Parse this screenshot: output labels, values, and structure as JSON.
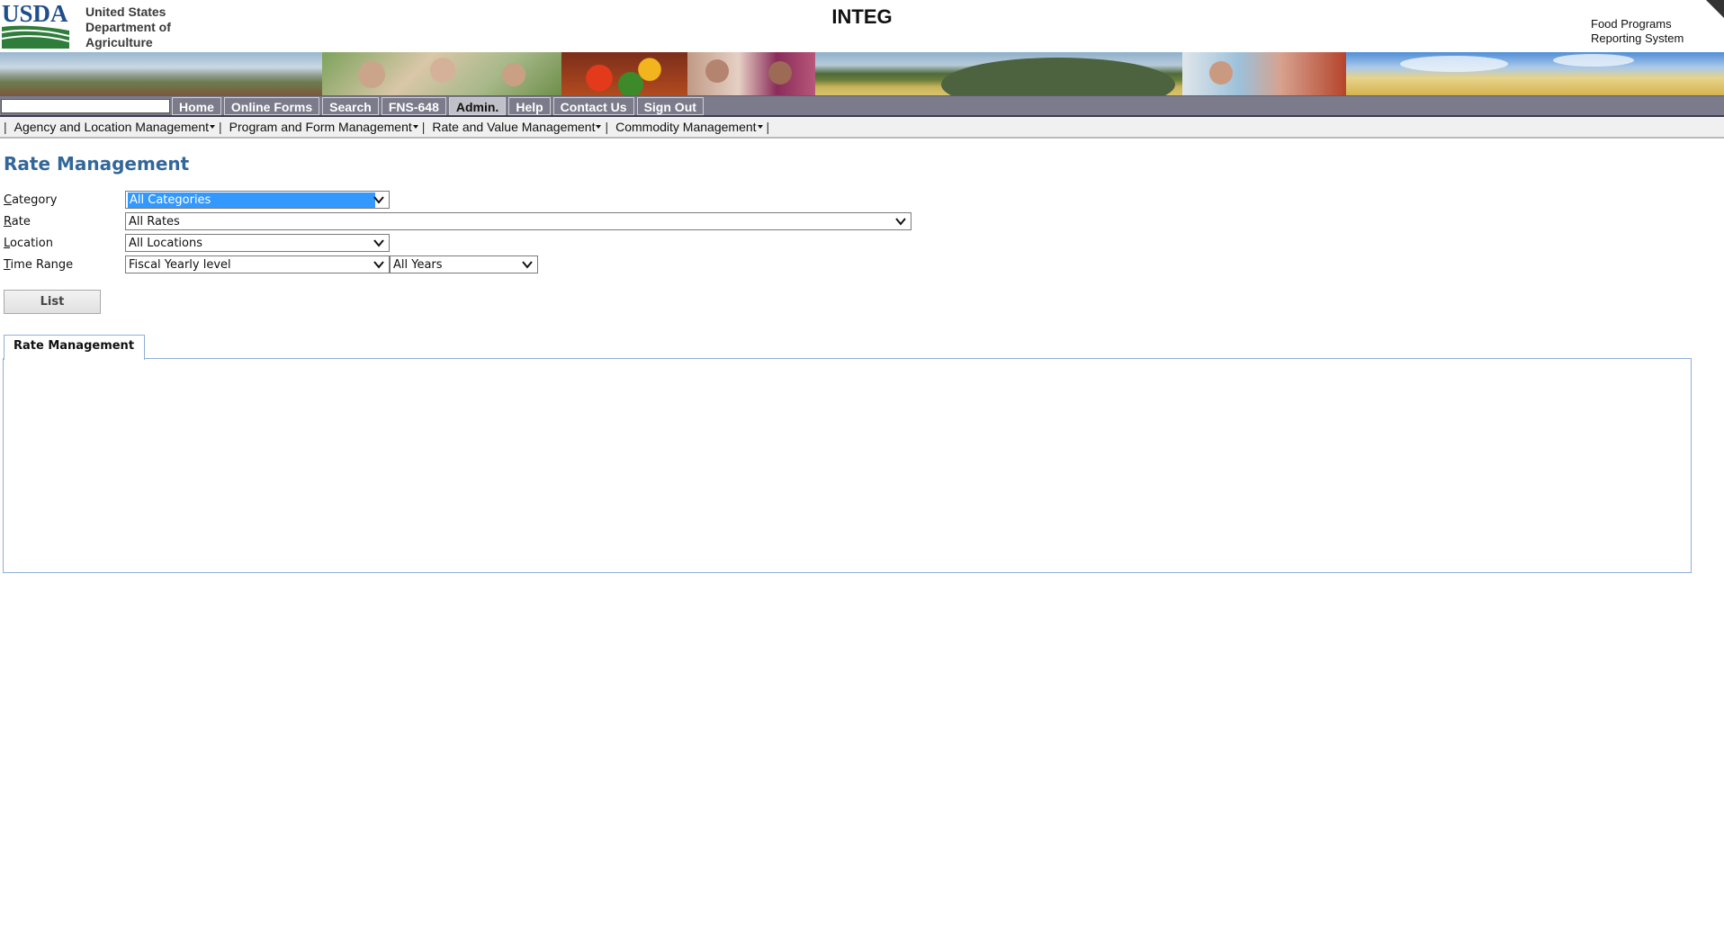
{
  "header": {
    "logo_text": "USDA",
    "org_lines": [
      "United States",
      "Department of",
      "Agriculture"
    ],
    "app_title": "INTEG",
    "system_lines": [
      "Food Programs",
      "Reporting System"
    ]
  },
  "nav": {
    "search_value": "",
    "buttons": [
      {
        "label": "Home"
      },
      {
        "label": "Online Forms"
      },
      {
        "label": "Search"
      },
      {
        "label": "FNS-648"
      },
      {
        "label": "Admin.",
        "active": true
      },
      {
        "label": "Help"
      },
      {
        "label": "Contact Us"
      },
      {
        "label": "Sign Out"
      }
    ]
  },
  "submenu": {
    "items": [
      {
        "label": "Agency and Location Management"
      },
      {
        "label": "Program and Form Management"
      },
      {
        "label": "Rate and Value Management"
      },
      {
        "label": "Commodity Management"
      }
    ]
  },
  "page": {
    "title": "Rate Management",
    "form": {
      "category": {
        "label_first": "C",
        "label_rest": "ategory",
        "value": "All Categories"
      },
      "rate": {
        "label_first": "R",
        "label_rest": "ate",
        "value": "All Rates"
      },
      "location": {
        "label_first": "L",
        "label_rest": "ocation",
        "value": "All Locations"
      },
      "time_range": {
        "label_first": "T",
        "label_rest": "ime Range",
        "value": "Fiscal Yearly level",
        "year_value": "All Years"
      }
    },
    "list_button": "List",
    "tab_label": "Rate Management"
  },
  "colors": {
    "title_blue": "#336699",
    "nav_gray": "#7b7b8b",
    "usda_blue": "#1f4e8c",
    "usda_green": "#2e7d3a",
    "select_highlight": "#3399ff"
  }
}
